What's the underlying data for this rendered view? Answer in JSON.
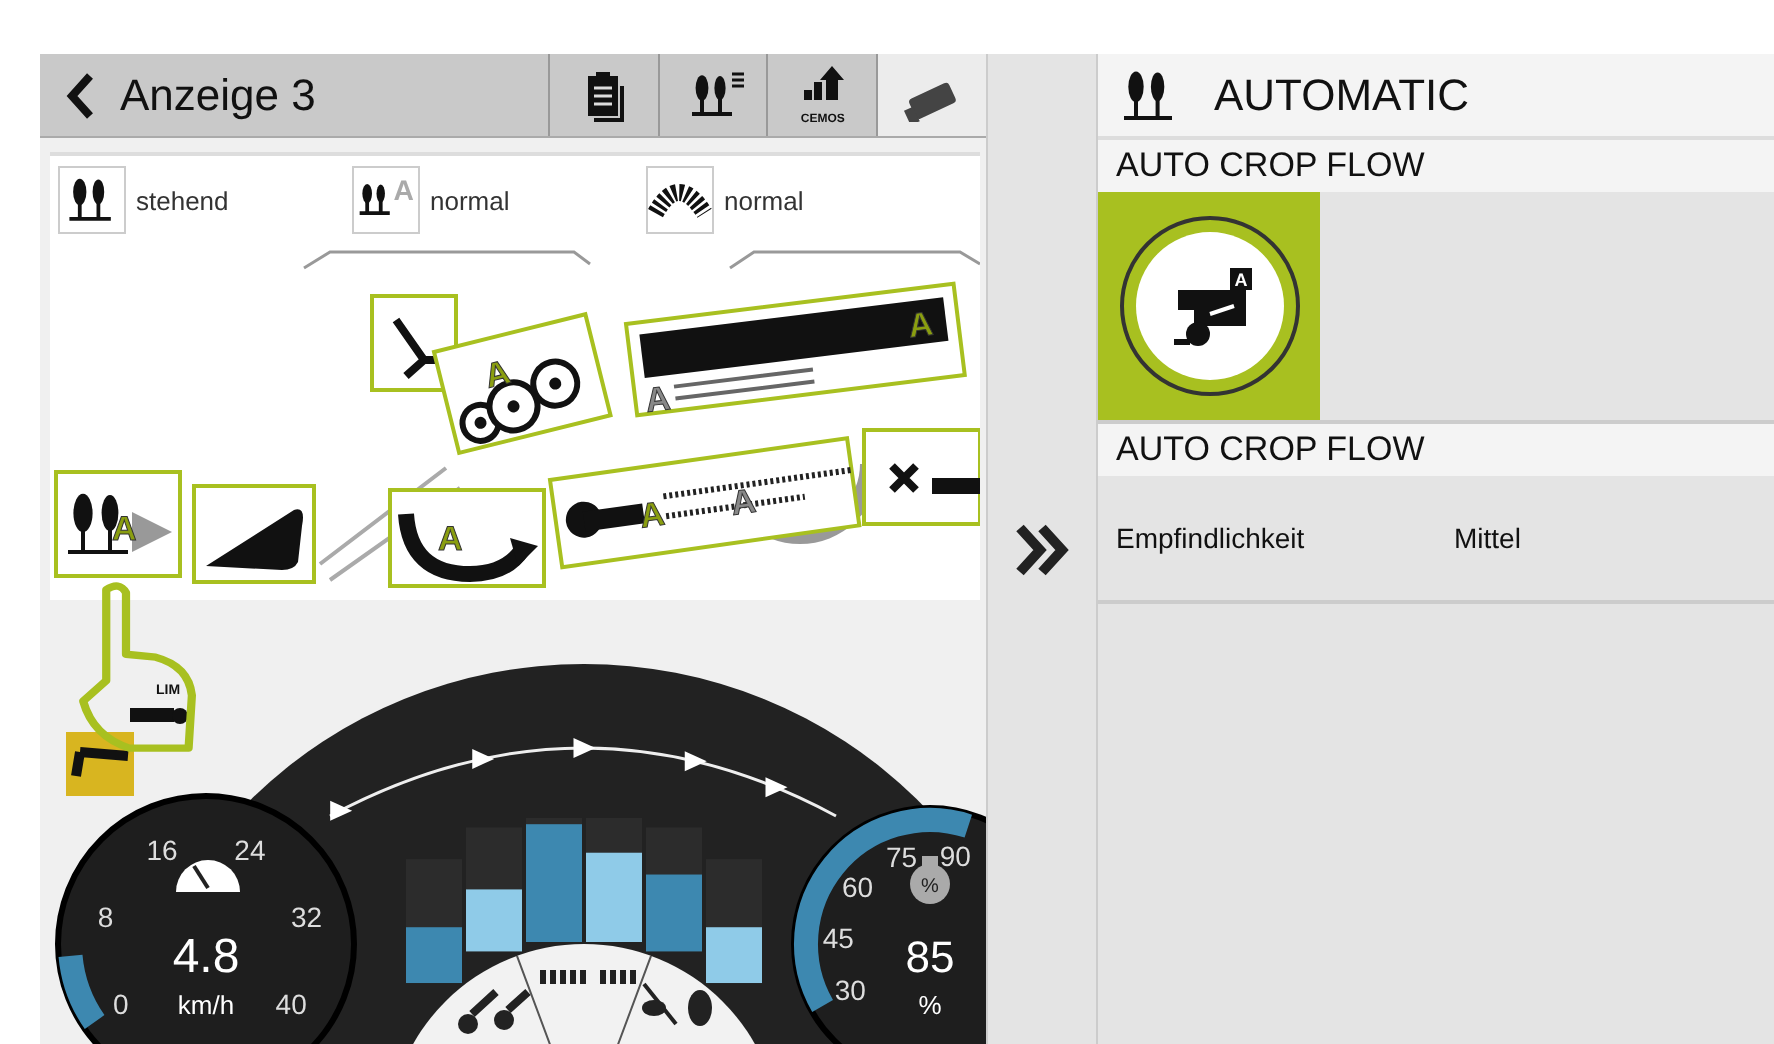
{
  "header": {
    "title": "Anzeige 3"
  },
  "tabs": [
    {
      "kind": "report",
      "selected": false
    },
    {
      "kind": "crop-list",
      "selected": false
    },
    {
      "kind": "cemos",
      "label": "CEMOS",
      "selected": false
    },
    {
      "kind": "camera",
      "selected": true
    }
  ],
  "crop_settings": [
    {
      "kind": "crop",
      "value": "stehend"
    },
    {
      "kind": "crop-auto",
      "mark": "A",
      "value": "normal"
    },
    {
      "kind": "straw",
      "value": "normal"
    }
  ],
  "diagram": {
    "components": [
      {
        "kind": "intake",
        "marks": [
          {
            "text": "A",
            "active": true
          }
        ]
      },
      {
        "kind": "feeder"
      },
      {
        "kind": "stone-trap"
      },
      {
        "kind": "threshing",
        "marks": [
          {
            "text": "A",
            "active": true
          }
        ]
      },
      {
        "kind": "separation",
        "marks": [
          {
            "text": "A",
            "active": true
          },
          {
            "text": "A",
            "active": false
          }
        ]
      },
      {
        "kind": "cleaning",
        "marks": [
          {
            "text": "A",
            "active": true
          },
          {
            "text": "A",
            "active": false
          }
        ]
      },
      {
        "kind": "returns",
        "marks": [
          {
            "text": "A",
            "active": true
          }
        ]
      },
      {
        "kind": "chopper"
      }
    ]
  },
  "limit_indicator": {
    "label": "LIM"
  },
  "speed_gauge": {
    "ticks": [
      "0",
      "8",
      "16",
      "24",
      "32",
      "40"
    ],
    "level": 0.12,
    "value": "4.8",
    "unit": "km/h"
  },
  "load_bars": [
    {
      "level": 0.45,
      "color": "#3d88b0"
    },
    {
      "level": 0.5,
      "color": "#8fcbe8"
    },
    {
      "level": 0.95,
      "color": "#3d88b0"
    },
    {
      "level": 0.72,
      "color": "#8fcbe8"
    },
    {
      "level": 0.62,
      "color": "#3d88b0"
    },
    {
      "level": 0.45,
      "color": "#8fcbe8"
    }
  ],
  "engine_gauge": {
    "ticks": [
      "90",
      "75",
      "60",
      "45",
      "30"
    ],
    "level": 0.92,
    "icon_label": "%",
    "value": "85",
    "unit": "%"
  },
  "panel": {
    "title": "AUTOMATIC",
    "sections": [
      {
        "kind": "tile",
        "title": "AUTO CROP FLOW",
        "badge": "A",
        "active": true
      },
      {
        "kind": "settings",
        "title": "AUTO CROP FLOW",
        "rows": [
          {
            "label": "Empfindlichkeit",
            "value": "Mittel"
          }
        ]
      }
    ]
  }
}
